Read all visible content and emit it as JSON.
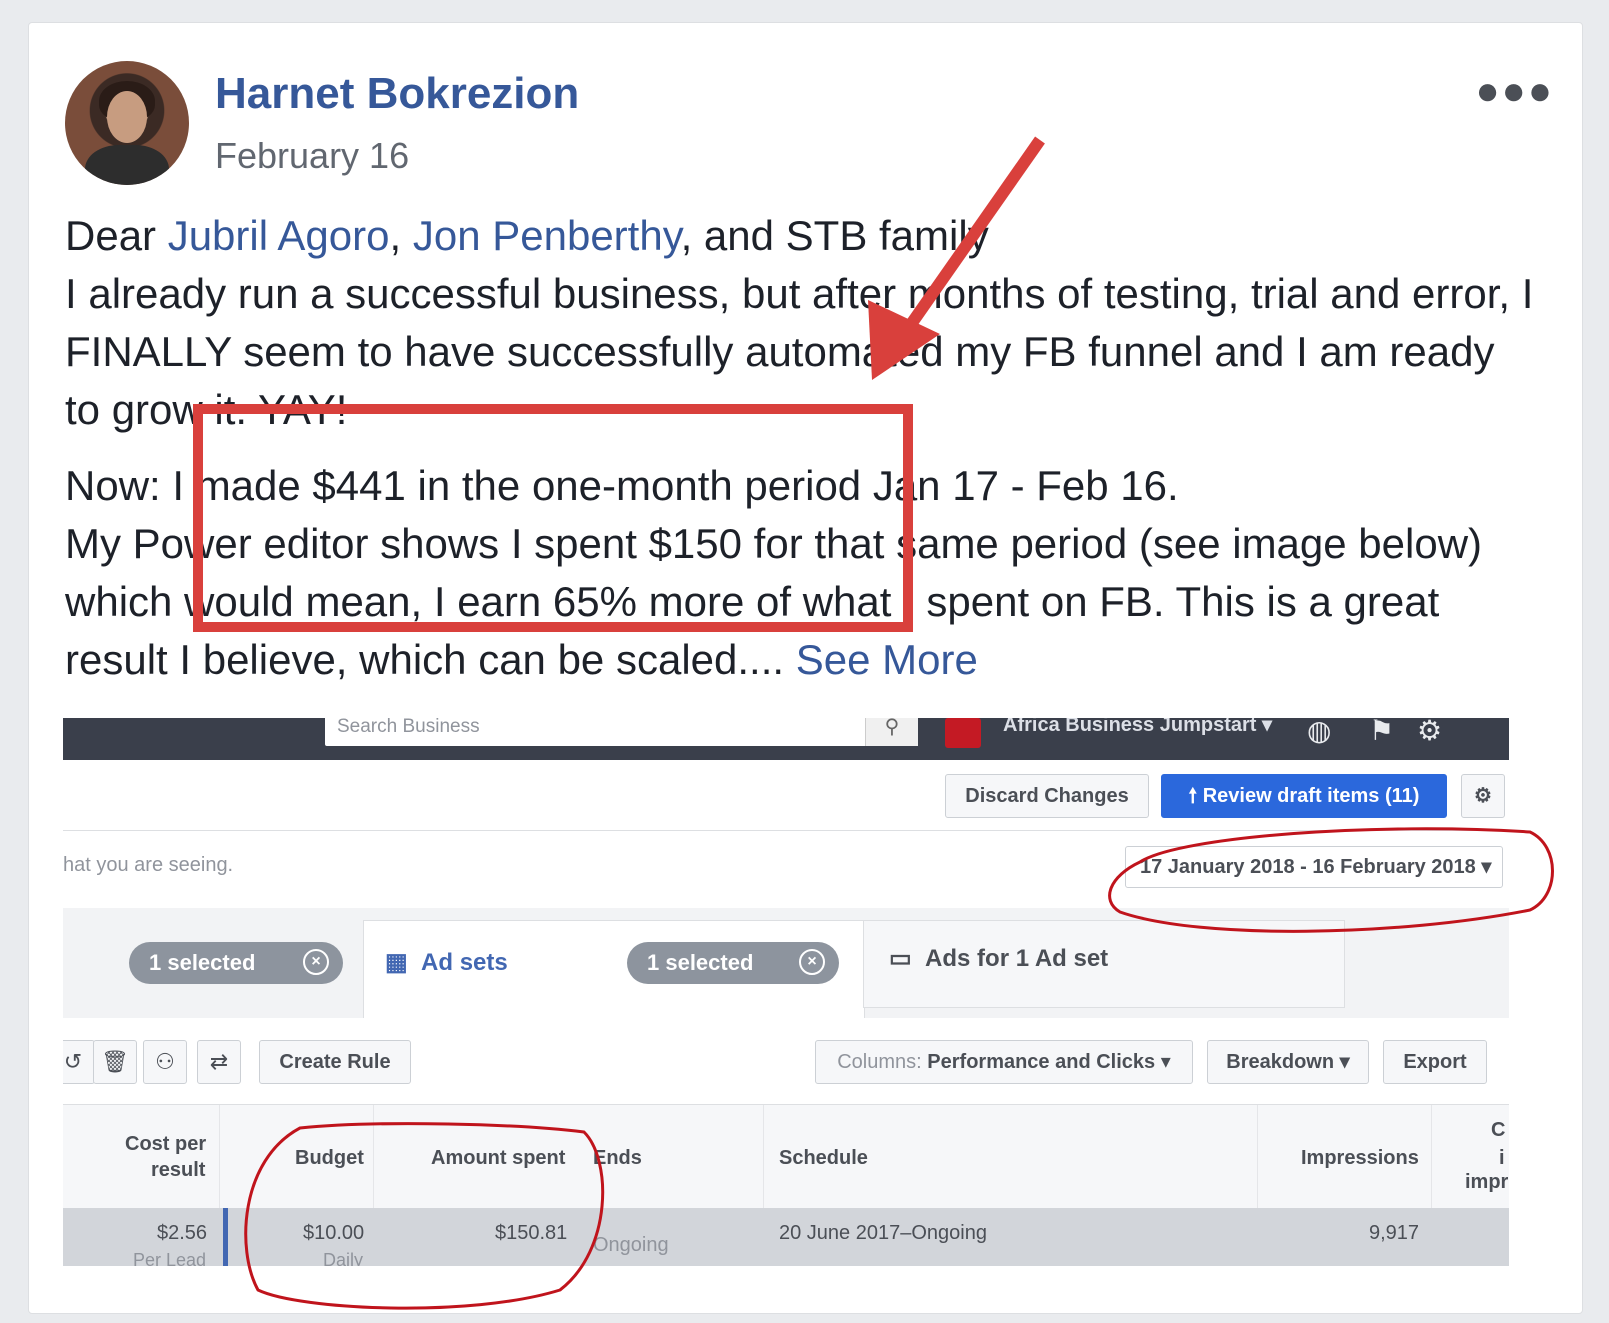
{
  "post": {
    "author": "Harnet Bokrezion",
    "date": "February 16",
    "line1": {
      "prefix": "Dear ",
      "mention1": "Jubril Agoro",
      "sep": ", ",
      "mention2": "Jon Penberthy",
      "suffix": ", and STB family"
    },
    "para1": "I already run a successful business, but after months of testing, trial and error, I FINALLY seem to have successfully automated my FB funnel and I am ready to grow it. YAY!",
    "para2_line1": "Now: I made $441 in the one-month period Jan 17 - Feb 16.",
    "para2_rest": "My Power editor shows I spent $150 for that same period (see image below) which would mean, I earn 65% more of what I spent on FB. This is a great result I believe, which can be scaled.... ",
    "see_more": "See More"
  },
  "screenshot": {
    "search_placeholder": "Search Business",
    "account_name": "Africa Business Jumpstart",
    "discard_label": "Discard Changes",
    "review_label": "Review draft items (11)",
    "hint_text": "hat you are seeing.",
    "date_range": "17 January 2018 - 16 February 2018",
    "tabs": {
      "chip1": "1 selected",
      "adsets": "Ad sets",
      "chip2": "1 selected",
      "ads": "Ads for 1 Ad set"
    },
    "toolbar": {
      "create_rule": "Create Rule",
      "columns_prefix": "Columns:",
      "columns_value": "Performance and Clicks",
      "breakdown": "Breakdown",
      "export": "Export"
    },
    "table": {
      "headers": {
        "cost_per_result_1": "Cost per",
        "cost_per_result_2": "result",
        "budget": "Budget",
        "amount_spent": "Amount spent",
        "ends": "Ends",
        "schedule": "Schedule",
        "impressions": "Impressions",
        "cut1": "C",
        "cut2": "i",
        "cut3": "impr"
      },
      "row": {
        "cost": "$2.56",
        "cost_sub": "Per Lead",
        "budget": "$10.00",
        "budget_sub": "Daily",
        "amount_spent": "$150.81",
        "ends": "Ongoing",
        "schedule": "20 June 2017–Ongoing",
        "impressions": "9,917"
      }
    }
  },
  "annotation_color": "#d9403c",
  "circle_color": "#c0141c",
  "link_color": "#365899"
}
